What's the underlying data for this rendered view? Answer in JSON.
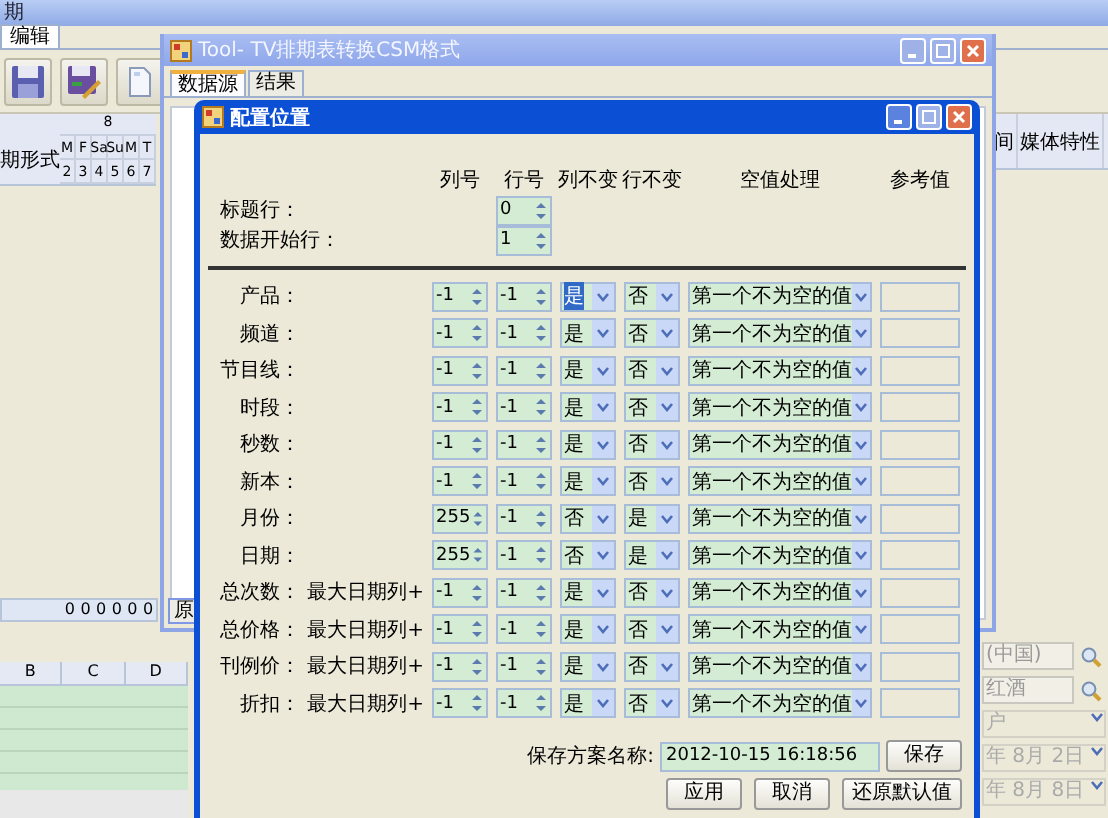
{
  "app": {
    "title": "期",
    "tab": "编辑",
    "grid_header": {
      "group": "8",
      "label": "期形式",
      "days": [
        "M",
        "F",
        "Sa",
        "Su",
        "M",
        "T"
      ],
      "dates": [
        "2",
        "3",
        "4",
        "5",
        "6",
        "7"
      ]
    },
    "right_columns": [
      "间",
      "媒体特性"
    ],
    "totals": [
      "0",
      "0",
      "0",
      "0",
      "0",
      "0"
    ],
    "sheet_columns": [
      "B",
      "C",
      "D"
    ],
    "filters": [
      {
        "kind": "search",
        "value": "(中国)"
      },
      {
        "kind": "search",
        "value": "红酒"
      },
      {
        "kind": "select",
        "value": "户"
      },
      {
        "kind": "select",
        "value": "年 8月 2日"
      },
      {
        "kind": "select",
        "value": "年 8月 8日"
      }
    ]
  },
  "tool_window": {
    "title": "Tool- TV排期表转换CSM格式",
    "tabs": [
      {
        "label": "数据源",
        "selected": true
      },
      {
        "label": "结果",
        "selected": false
      }
    ],
    "footer_tab": "原"
  },
  "dialog": {
    "title": "配置位置",
    "headers": [
      "列号",
      "行号",
      "列不变",
      "行不变",
      "空值处理",
      "参考值"
    ],
    "header_rows": [
      {
        "label": "标题行：",
        "row": "0"
      },
      {
        "label": "数据开始行：",
        "row": "1"
      }
    ],
    "fields": [
      {
        "label": "产品：",
        "column": "-1",
        "row": "-1",
        "column_fixed": "是",
        "row_fixed": "否",
        "empty_handling": "第一个不为空的值",
        "focused": true
      },
      {
        "label": "频道：",
        "column": "-1",
        "row": "-1",
        "column_fixed": "是",
        "row_fixed": "否",
        "empty_handling": "第一个不为空的值",
        "focused": false
      },
      {
        "label": "节目线：",
        "column": "-1",
        "row": "-1",
        "column_fixed": "是",
        "row_fixed": "否",
        "empty_handling": "第一个不为空的值",
        "focused": false
      },
      {
        "label": "时段：",
        "column": "-1",
        "row": "-1",
        "column_fixed": "是",
        "row_fixed": "否",
        "empty_handling": "第一个不为空的值",
        "focused": false
      },
      {
        "label": "秒数：",
        "column": "-1",
        "row": "-1",
        "column_fixed": "是",
        "row_fixed": "否",
        "empty_handling": "第一个不为空的值",
        "focused": false
      },
      {
        "label": "新本：",
        "column": "-1",
        "row": "-1",
        "column_fixed": "是",
        "row_fixed": "否",
        "empty_handling": "第一个不为空的值",
        "focused": false
      },
      {
        "label": "月份：",
        "column": "255",
        "row": "-1",
        "column_fixed": "否",
        "row_fixed": "是",
        "empty_handling": "第一个不为空的值",
        "focused": false
      },
      {
        "label": "日期：",
        "column": "255",
        "row": "-1",
        "column_fixed": "否",
        "row_fixed": "是",
        "empty_handling": "第一个不为空的值",
        "focused": false
      },
      {
        "label": "总次数：",
        "prefix": "最大日期列+",
        "column": "-1",
        "row": "-1",
        "column_fixed": "是",
        "row_fixed": "否",
        "empty_handling": "第一个不为空的值",
        "focused": false
      },
      {
        "label": "总价格：",
        "prefix": "最大日期列+",
        "column": "-1",
        "row": "-1",
        "column_fixed": "是",
        "row_fixed": "否",
        "empty_handling": "第一个不为空的值",
        "focused": false
      },
      {
        "label": "刊例价：",
        "prefix": "最大日期列+",
        "column": "-1",
        "row": "-1",
        "column_fixed": "是",
        "row_fixed": "否",
        "empty_handling": "第一个不为空的值",
        "focused": false
      },
      {
        "label": "折扣：",
        "prefix": "最大日期列+",
        "column": "-1",
        "row": "-1",
        "column_fixed": "是",
        "row_fixed": "否",
        "empty_handling": "第一个不为空的值",
        "focused": false
      }
    ],
    "scheme_label": "保存方案名称:",
    "scheme_name": "2012-10-15 16:18:56",
    "save_button": "保存",
    "buttons": [
      "应用",
      "取消",
      "还原默认值"
    ]
  }
}
